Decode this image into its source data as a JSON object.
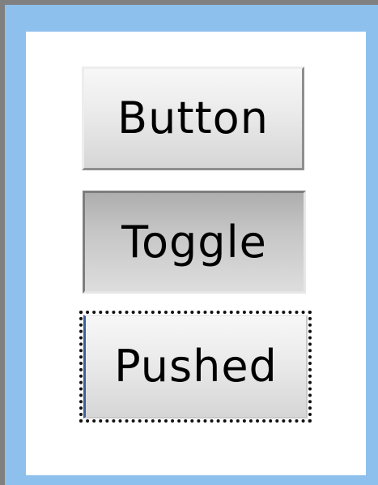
{
  "buttons": {
    "normal": {
      "label": "Button"
    },
    "toggle": {
      "label": "Toggle"
    },
    "pushed": {
      "label": "Pushed"
    }
  },
  "colors": {
    "frame": "#8ec0ee",
    "panel": "#ffffff",
    "focus_outline": "#111111"
  }
}
